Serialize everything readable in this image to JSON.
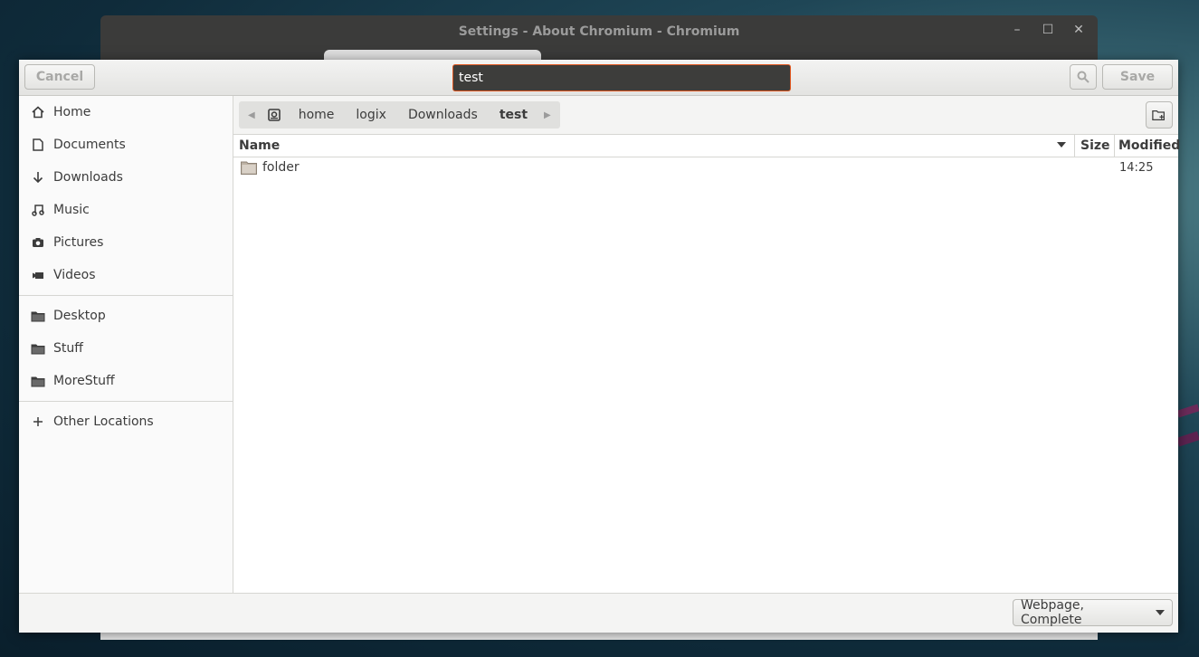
{
  "background_window": {
    "title": "Settings - About Chromium - Chromium"
  },
  "dialog": {
    "cancel_label": "Cancel",
    "save_label": "Save",
    "filename_value": "test"
  },
  "sidebar": {
    "places": [
      {
        "label": "Home",
        "icon": "home-icon"
      },
      {
        "label": "Documents",
        "icon": "document-icon"
      },
      {
        "label": "Downloads",
        "icon": "download-arrow-icon"
      },
      {
        "label": "Music",
        "icon": "music-note-icon"
      },
      {
        "label": "Pictures",
        "icon": "camera-icon"
      },
      {
        "label": "Videos",
        "icon": "video-camera-icon"
      }
    ],
    "bookmarks": [
      {
        "label": "Desktop",
        "icon": "folder-icon"
      },
      {
        "label": "Stuff",
        "icon": "folder-icon"
      },
      {
        "label": "MoreStuff",
        "icon": "folder-icon"
      }
    ],
    "other_locations": {
      "label": "Other Locations",
      "icon": "plus-icon"
    }
  },
  "pathbar": {
    "crumbs": [
      "home",
      "logix",
      "Downloads",
      "test"
    ]
  },
  "listview": {
    "columns": {
      "name": "Name",
      "size": "Size",
      "modified": "Modified"
    },
    "rows": [
      {
        "name": "folder",
        "size": "",
        "modified": "14:25"
      }
    ]
  },
  "footer": {
    "filetype": "Webpage, Complete"
  },
  "colors": {
    "accent": "#e0561e",
    "headerbar_bg": "#e9e9e7"
  }
}
